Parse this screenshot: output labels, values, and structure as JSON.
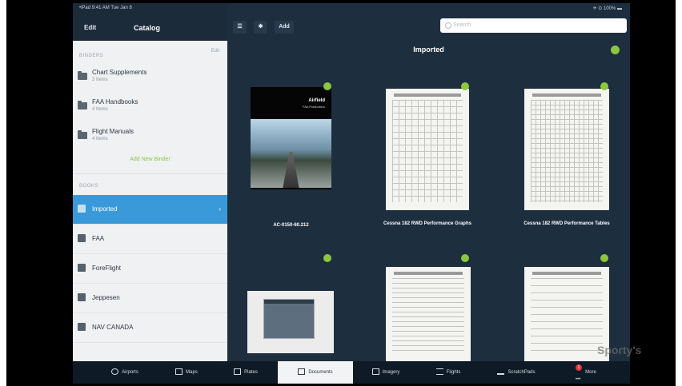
{
  "status_bar": {
    "left": "•iPad  9:41 AM  Tue Jan 8",
    "right": "✈ ⊙ 100% ▬"
  },
  "sidebar": {
    "edit_label": "Edit",
    "title": "Catalog",
    "binders_label": "BINDERS",
    "binders_edit": "Edit",
    "binders": [
      {
        "name": "Chart Supplements",
        "count": "3 Items"
      },
      {
        "name": "FAA Handbooks",
        "count": "4 Items"
      },
      {
        "name": "Flight Manuals",
        "count": "4 Items"
      }
    ],
    "add_binder": "Add New Binder",
    "books_label": "BOOKS",
    "books": [
      {
        "label": "Imported",
        "selected": true
      },
      {
        "label": "FAA"
      },
      {
        "label": "ForeFlight"
      },
      {
        "label": "Jeppesen"
      },
      {
        "label": "NAV CANADA"
      }
    ]
  },
  "toolbar": {
    "menu_icon": "list-icon",
    "settings_icon": "gear-icon",
    "add_label": "Add",
    "search_placeholder": "Search"
  },
  "main": {
    "title": "Imported",
    "documents": [
      {
        "label": "AC-0150-60.212",
        "cover_title": "Airfield",
        "cover_sub": "FAA Publication"
      },
      {
        "label": "Cessna 182 RWD Performance Graphs"
      },
      {
        "label": "Cessna 182 RWD Performance Tables"
      },
      {
        "label": ""
      },
      {
        "label": ""
      },
      {
        "label": ""
      }
    ]
  },
  "tabbar": {
    "tabs": [
      "Airports",
      "Maps",
      "Plates",
      "Documents",
      "Imagery",
      "Flights",
      "ScratchPads",
      "More"
    ],
    "active": "Documents",
    "more_badge": "1"
  },
  "watermark": "Sporty's",
  "colors": {
    "accent": "#3a9ad9",
    "sync": "#8dc63f",
    "chrome": "#1d2e3e"
  }
}
